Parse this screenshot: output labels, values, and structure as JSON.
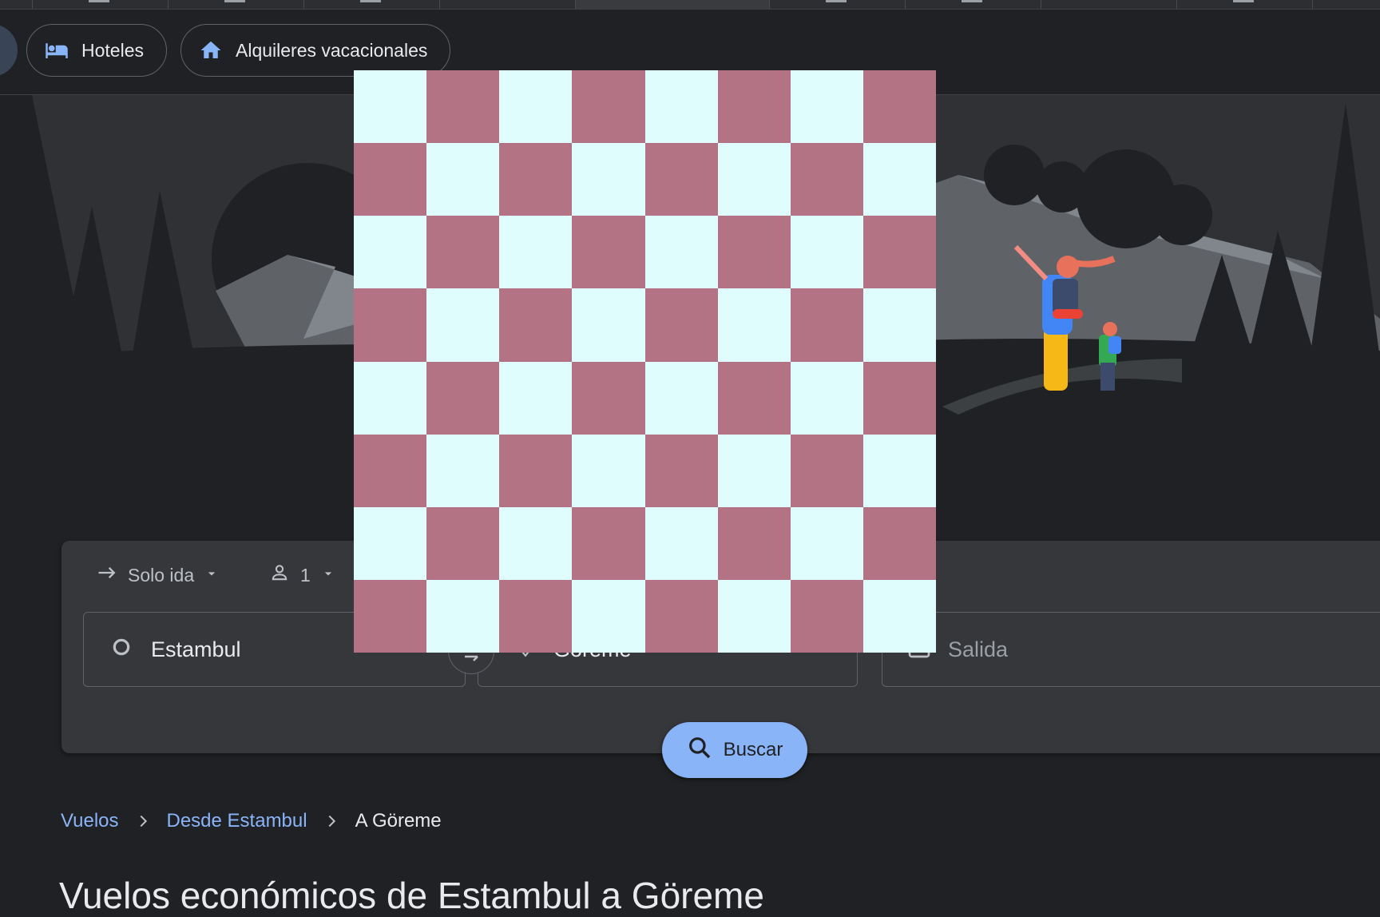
{
  "chips": {
    "hotels_label": "Hoteles",
    "vacation_rentals_label": "Alquileres vacacionales"
  },
  "search": {
    "trip_type": "Solo ida",
    "passengers": "1",
    "origin": "Estambul",
    "destination": "Göreme",
    "departure_placeholder": "Salida",
    "search_label": "Buscar"
  },
  "breadcrumb": {
    "item1": "Vuelos",
    "item2": "Desde Estambul",
    "current": "A Göreme"
  },
  "page_title": "Vuelos económicos de Estambul a Göreme",
  "colors": {
    "background": "#202124",
    "accent": "#8ab4f8",
    "checker_light": "#e0fdfd",
    "checker_dark": "#b47285"
  },
  "icons": [
    "bed-icon",
    "home-icon",
    "arrow-right-icon",
    "person-icon",
    "dropdown-icon",
    "circle-icon",
    "swap-icon",
    "place-pin-icon",
    "calendar-icon",
    "search-icon",
    "chevron-right-icon"
  ]
}
